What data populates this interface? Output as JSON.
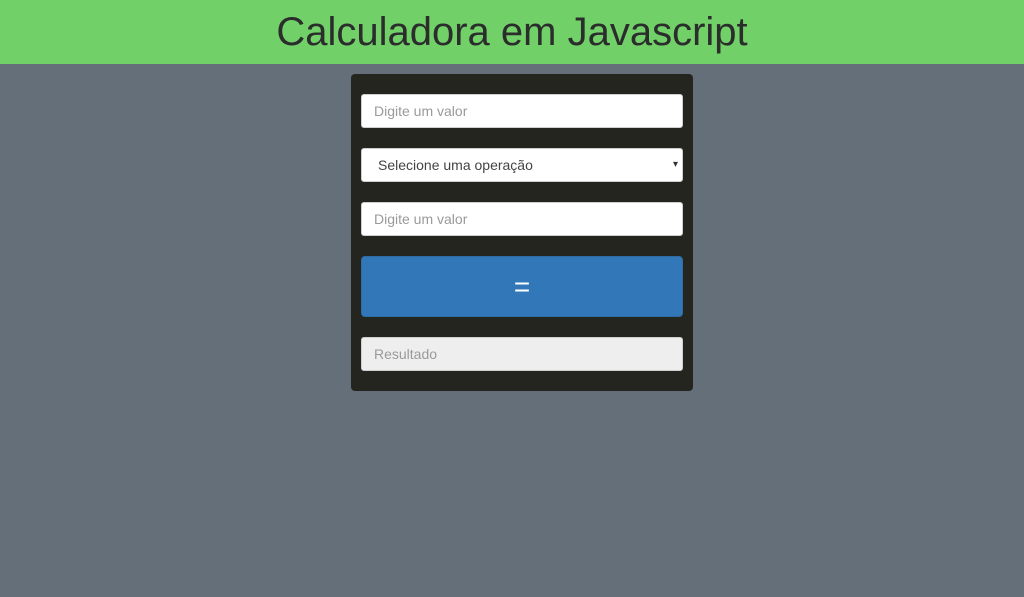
{
  "header": {
    "title": "Calculadora em Javascript"
  },
  "calculator": {
    "first_value_placeholder": "Digite um valor",
    "operation_selected": "Selecione uma operação",
    "second_value_placeholder": "Digite um valor",
    "equals_label": "=",
    "result_placeholder": "Resultado"
  },
  "colors": {
    "header_bg": "#72d069",
    "page_bg": "#646f79",
    "panel_bg": "#252520",
    "button_bg": "#3278b8"
  },
  "icons": {
    "select_arrow": "chevron-down-icon"
  }
}
